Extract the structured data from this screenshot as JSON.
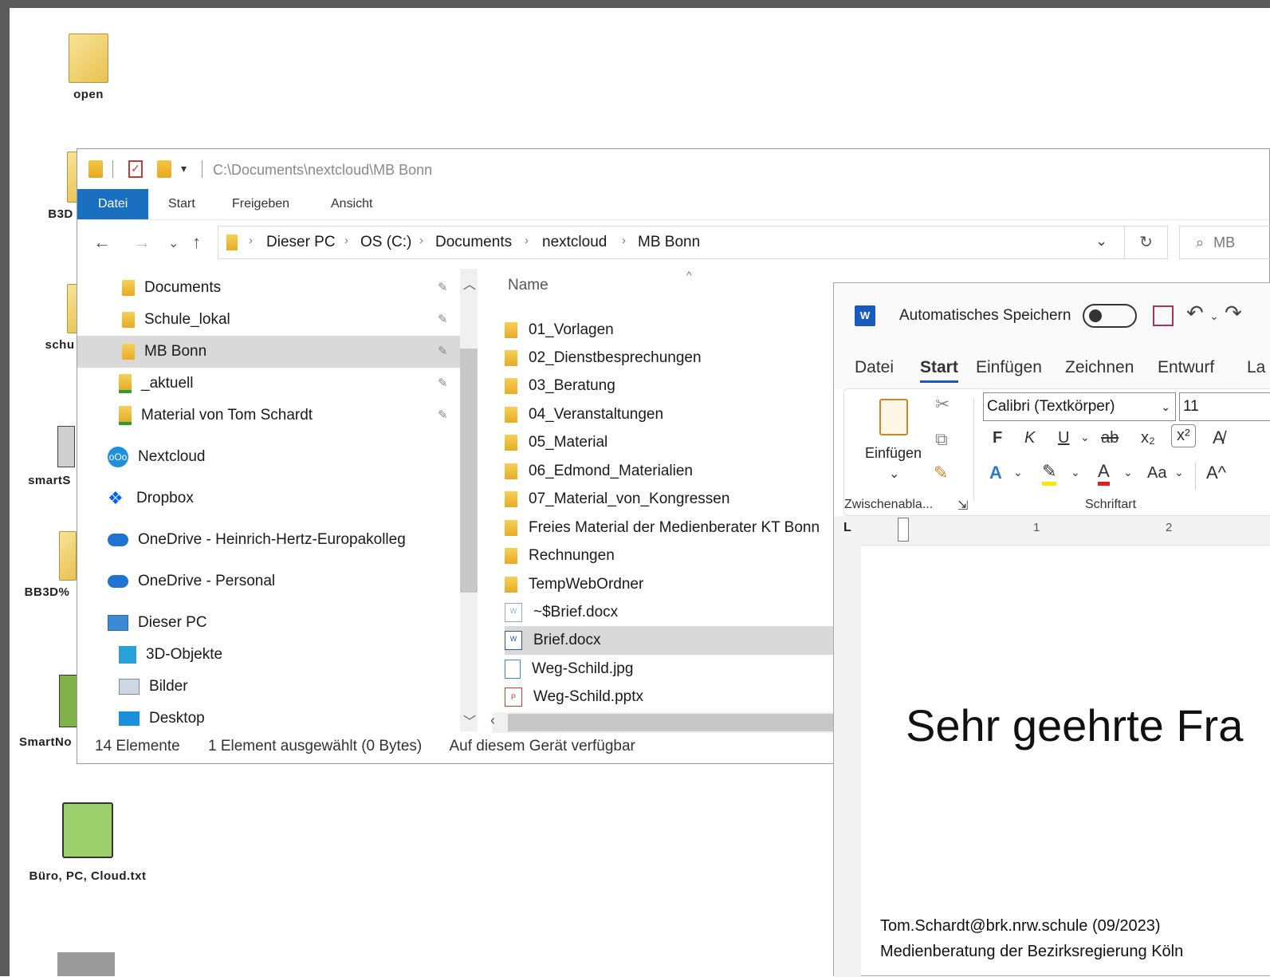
{
  "desktop": {
    "icons": [
      {
        "label": "open"
      },
      {
        "label": "B3D"
      },
      {
        "label": "schu"
      },
      {
        "label": "smartS"
      },
      {
        "label": "BB3D%"
      },
      {
        "label": "SmartNo"
      },
      {
        "label": "Büro, PC, Cloud.txt"
      }
    ]
  },
  "explorer": {
    "title_path": "C:\\Documents\\nextcloud\\MB Bonn",
    "ribbon_tabs": [
      "Datei",
      "Start",
      "Freigeben",
      "Ansicht"
    ],
    "breadcrumb": [
      "Dieser PC",
      "OS (C:)",
      "Documents",
      "nextcloud",
      "MB Bonn"
    ],
    "search_placeholder": "MB",
    "nav_items": [
      {
        "label": "Documents",
        "icon": "folder-icon",
        "pinned": true
      },
      {
        "label": "Schule_lokal",
        "icon": "folder-icon",
        "pinned": true
      },
      {
        "label": "MB Bonn",
        "icon": "folder-icon",
        "pinned": true,
        "selected": true
      },
      {
        "label": "_aktuell",
        "icon": "folder-synced-icon",
        "pinned": true
      },
      {
        "label": "Material von Tom Schardt",
        "icon": "shared-folder-icon",
        "pinned": true
      },
      {
        "label": "Nextcloud",
        "icon": "nextcloud-icon"
      },
      {
        "label": "Dropbox",
        "icon": "dropbox-icon"
      },
      {
        "label": "OneDrive - Heinrich-Hertz-Europakolleg",
        "icon": "onedrive-icon"
      },
      {
        "label": "OneDrive - Personal",
        "icon": "onedrive-icon"
      },
      {
        "label": "Dieser PC",
        "icon": "pc-icon"
      },
      {
        "label": "3D-Objekte",
        "icon": "cube-icon"
      },
      {
        "label": "Bilder",
        "icon": "pictures-icon"
      },
      {
        "label": "Desktop",
        "icon": "desktop-icon"
      }
    ],
    "column_name": "Name",
    "files": [
      {
        "name": "01_Vorlagen",
        "type": "folder"
      },
      {
        "name": "02_Dienstbesprechungen",
        "type": "folder"
      },
      {
        "name": "03_Beratung",
        "type": "folder"
      },
      {
        "name": "04_Veranstaltungen",
        "type": "folder"
      },
      {
        "name": "05_Material",
        "type": "folder"
      },
      {
        "name": "06_Edmond_Materialien",
        "type": "folder"
      },
      {
        "name": "07_Material_von_Kongressen",
        "type": "folder"
      },
      {
        "name": "Freies Material der Medienberater KT Bonn",
        "type": "folder"
      },
      {
        "name": "Rechnungen",
        "type": "folder"
      },
      {
        "name": "TempWebOrdner",
        "type": "folder"
      },
      {
        "name": "~$Brief.docx",
        "type": "docx-temp"
      },
      {
        "name": "Brief.docx",
        "type": "docx",
        "selected": true
      },
      {
        "name": "Weg-Schild.jpg",
        "type": "jpg"
      },
      {
        "name": "Weg-Schild.pptx",
        "type": "pptx"
      }
    ],
    "status": {
      "count": "14 Elemente",
      "selection": "1 Element ausgewählt (0 Bytes)",
      "availability": "Auf diesem Gerät verfügbar"
    }
  },
  "word": {
    "autosave_label": "Automatisches Speichern",
    "tabs": [
      "Datei",
      "Start",
      "Einfügen",
      "Zeichnen",
      "Entwurf",
      "La"
    ],
    "active_tab": "Start",
    "paste_label": "Einfügen",
    "clipboard_group": "Zwischenabla...",
    "font_group": "Schriftart",
    "font_name": "Calibri (Textkörper)",
    "font_size": "11",
    "bold": "F",
    "italic": "K",
    "underline": "U",
    "strike": "ab",
    "subscript": "x₂",
    "superscript": "x²",
    "case": "Aa",
    "grow": "A^",
    "ruler_marks": [
      "1",
      "2"
    ],
    "document_text": "Sehr geehrte Fra"
  },
  "footer": {
    "line1": "Tom.Schardt@brk.nrw.schule (09/2023)",
    "line2": "Medienberatung der Bezirksregierung Köln"
  }
}
